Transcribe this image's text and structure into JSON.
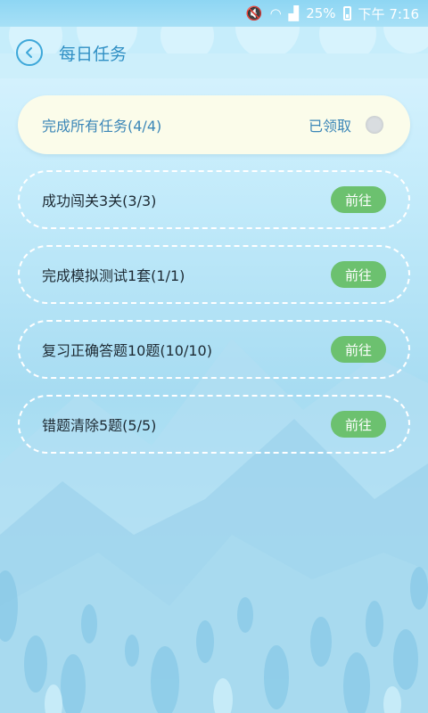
{
  "status_bar": {
    "battery": "25%",
    "time": "下午 7:16",
    "icons": [
      "mute-icon",
      "wifi-icon",
      "signal-icon",
      "battery-icon"
    ]
  },
  "header": {
    "title": "每日任务",
    "back_icon": "chevron-left-icon"
  },
  "summary": {
    "label": "完成所有任务(4/4)",
    "status": "已领取"
  },
  "tasks": [
    {
      "label": "成功闯关3关(3/3)",
      "button": "前往"
    },
    {
      "label": "完成模拟测试1套(1/1)",
      "button": "前往"
    },
    {
      "label": "复习正确答题10题(10/10)",
      "button": "前往"
    },
    {
      "label": "错题清除5题(5/5)",
      "button": "前往"
    }
  ],
  "colors": {
    "accent": "#3da7d9",
    "button_green": "#6cc16f",
    "summary_bg": "#fbfcea"
  }
}
